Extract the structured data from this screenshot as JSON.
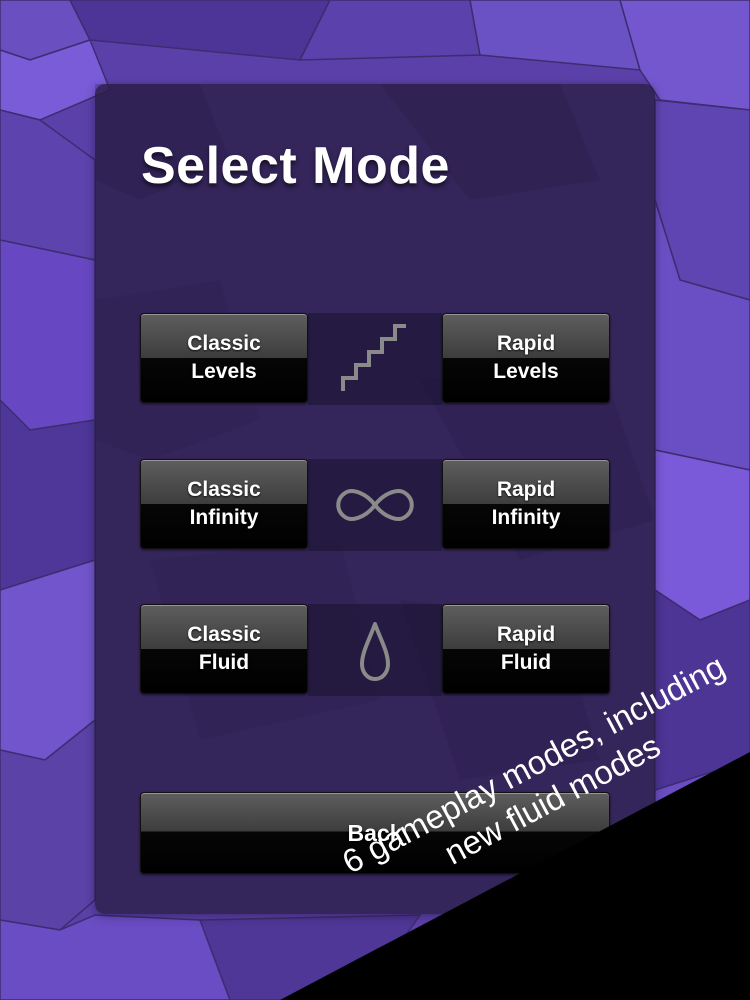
{
  "screen": {
    "title": "Select Mode"
  },
  "modes": [
    {
      "left": {
        "line1": "Classic",
        "line2": "Levels"
      },
      "icon": "stairs-icon",
      "right": {
        "line1": "Rapid",
        "line2": "Levels"
      }
    },
    {
      "left": {
        "line1": "Classic",
        "line2": "Infinity"
      },
      "icon": "infinity-icon",
      "right": {
        "line1": "Rapid",
        "line2": "Infinity"
      }
    },
    {
      "left": {
        "line1": "Classic",
        "line2": "Fluid"
      },
      "icon": "droplet-icon",
      "right": {
        "line1": "Rapid",
        "line2": "Fluid"
      }
    }
  ],
  "back": {
    "label": "Back"
  },
  "promo": {
    "line1": "6 gameplay modes, including",
    "line2": "new fluid modes"
  },
  "colors": {
    "background": "#5a3fa8",
    "panel": "#261a3c",
    "icon_stroke": "#8a8a8a",
    "banner": "#000000",
    "text": "#ffffff"
  }
}
